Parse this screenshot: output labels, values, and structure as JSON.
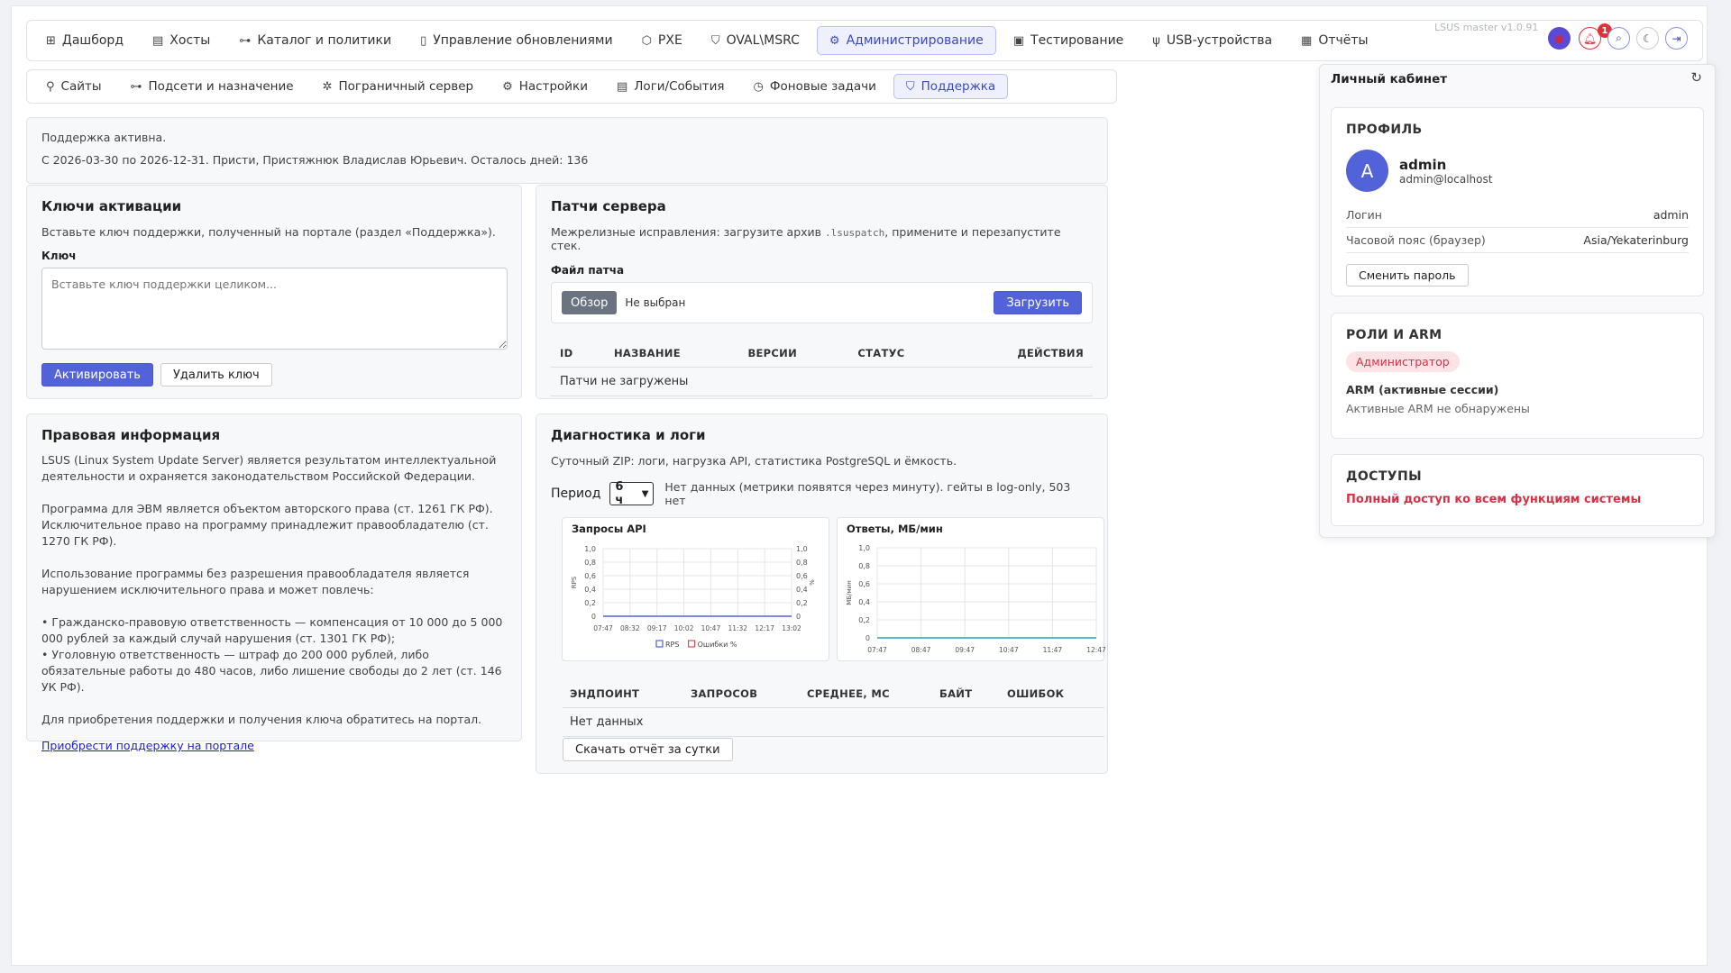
{
  "top_nav": {
    "items": [
      {
        "label": "Дашборд",
        "icon": "dashboard-icon",
        "glyph": "⊞"
      },
      {
        "label": "Хосты",
        "icon": "hosts-icon",
        "glyph": "▤"
      },
      {
        "label": "Каталог и политики",
        "icon": "catalog-icon",
        "glyph": "⊶"
      },
      {
        "label": "Управление обновлениями",
        "icon": "updates-icon",
        "glyph": "▯"
      },
      {
        "label": "PXE",
        "icon": "pxe-icon",
        "glyph": "⬡"
      },
      {
        "label": "OVAL\\MSRC",
        "icon": "shield-check-icon",
        "glyph": "⛉"
      },
      {
        "label": "Администрирование",
        "icon": "admin-icon",
        "glyph": "⚙",
        "active": true
      },
      {
        "label": "Тестирование",
        "icon": "testing-icon",
        "glyph": "▣"
      },
      {
        "label": "USB-устройства",
        "icon": "usb-icon",
        "glyph": "ψ"
      },
      {
        "label": "Отчёты",
        "icon": "reports-icon",
        "glyph": "▦"
      }
    ],
    "version": "LSUS master v1.0.91",
    "notification_count": "1"
  },
  "sub_nav": {
    "items": [
      {
        "label": "Сайты",
        "icon": "sites-icon",
        "glyph": "⚲"
      },
      {
        "label": "Подсети и назначение",
        "icon": "subnets-icon",
        "glyph": "⊶"
      },
      {
        "label": "Пограничный сервер",
        "icon": "edge-server-icon",
        "glyph": "✲"
      },
      {
        "label": "Настройки",
        "icon": "settings-icon",
        "glyph": "⚙"
      },
      {
        "label": "Логи/События",
        "icon": "logs-icon",
        "glyph": "▤"
      },
      {
        "label": "Фоновые задачи",
        "icon": "clock-icon",
        "glyph": "◷"
      },
      {
        "label": "Поддержка",
        "icon": "support-icon",
        "glyph": "⛉",
        "active": true
      }
    ]
  },
  "support_status": {
    "line1": "Поддержка активна.",
    "line2": "С 2026-03-30 по 2026-12-31. Присти, Пристяжнюк Владислав Юрьевич. Осталось дней: 136"
  },
  "activation": {
    "title": "Ключи активации",
    "description": "Вставьте ключ поддержки, полученный на портале (раздел «Поддержка»).",
    "key_label": "Ключ",
    "key_placeholder": "Вставьте ключ поддержки целиком...",
    "activate_button": "Активировать",
    "delete_button": "Удалить ключ"
  },
  "patches": {
    "title": "Патчи сервера",
    "description_before": "Межрелизные исправления: загрузите архив",
    "description_code": ".lsuspatch",
    "description_after": ", примените и перезапустите стек.",
    "file_label": "Файл патча",
    "browse_button": "Обзор",
    "no_file": "Не выбран",
    "upload_button": "Загрузить",
    "columns": [
      "ID",
      "НАЗВАНИЕ",
      "ВЕРСИИ",
      "СТАТУС",
      "ДЕЙСТВИЯ"
    ],
    "empty": "Патчи не загружены"
  },
  "legal": {
    "title": "Правовая информация",
    "p1": "LSUS (Linux System Update Server) является результатом интеллектуальной деятельности и охраняется законодательством Российской Федерации.",
    "p2a": "Программа для ЭВМ является объектом авторского права (ст. 1261 ГК РФ).",
    "p2b": "Исключительное право на программу принадлежит правообладателю (ст. 1270 ГК РФ).",
    "p3": "Использование программы без разрешения правообладателя является нарушением исключительного права и может повлечь:",
    "b1": "• Гражданско-правовую ответственность — компенсация от 10 000 до 5 000 000 рублей за каждый случай нарушения (ст. 1301 ГК РФ);",
    "b2": "• Уголовную ответственность — штраф до 200 000 рублей, либо обязательные работы до 480 часов, либо лишение свободы до 2 лет (ст. 146 УК РФ).",
    "p4": "Для приобретения поддержки и получения ключа обратитесь на портал.",
    "link": "Приобрести поддержку на портале"
  },
  "diagnostics": {
    "title": "Диагностика и логи",
    "description": "Суточный ZIP: логи, нагрузка API, статистика PostgreSQL и ёмкость.",
    "period_label": "Период",
    "period_value": "6 ч",
    "status": "Нет данных (метрики появятся через минуту). гейты в log-only, 503 нет",
    "columns": [
      "ЭНДПОИНТ",
      "ЗАПРОСОВ",
      "СРЕДНЕЕ, МС",
      "БАЙТ",
      "ОШИБОК"
    ],
    "empty": "Нет данных",
    "download_button": "Скачать отчёт за сутки"
  },
  "chart_data": [
    {
      "type": "line",
      "title": "Запросы API",
      "x": [
        "07:47",
        "08:32",
        "09:17",
        "10:02",
        "10:47",
        "11:32",
        "12:17",
        "13:02"
      ],
      "ylabel": "RPS",
      "y2label": "%",
      "ylim": [
        0,
        1.0
      ],
      "y2lim": [
        0,
        1.0
      ],
      "yticks": [
        "1,0",
        "0,8",
        "0,6",
        "0,4",
        "0,2",
        "0"
      ],
      "series": [
        {
          "name": "RPS",
          "values": [
            0,
            0,
            0,
            0,
            0,
            0,
            0,
            0
          ],
          "color": "#5262d9"
        },
        {
          "name": "Ошибки %",
          "values": [],
          "color": "#d9505a"
        }
      ],
      "legend": "bottom",
      "grid": true
    },
    {
      "type": "line",
      "title": "Ответы, МБ/мин",
      "x": [
        "07:47",
        "08:47",
        "09:47",
        "10:47",
        "11:47",
        "12:47"
      ],
      "ylabel": "МБ/мин",
      "ylim": [
        0,
        1.0
      ],
      "yticks": [
        "1,0",
        "0,8",
        "0,6",
        "0,4",
        "0,2",
        "0"
      ],
      "series": [
        {
          "values": [
            0,
            0,
            0,
            0,
            0,
            0
          ],
          "color": "#1aa8b5"
        }
      ],
      "grid": true
    }
  ],
  "profile": {
    "title": "Личный кабинет",
    "profile_header": "ПРОФИЛЬ",
    "avatar_letter": "A",
    "username": "admin",
    "email": "admin@localhost",
    "login_label": "Логин",
    "login_value": "admin",
    "tz_label": "Часовой пояс (браузер)",
    "tz_value": "Asia/Yekaterinburg",
    "change_password": "Сменить пароль",
    "roles_header": "РОЛИ И ARM",
    "role": "Администратор",
    "arm_label": "ARM (активные сессии)",
    "arm_empty": "Активные ARM не обнаружены",
    "access_header": "ДОСТУПЫ",
    "access_value": "Полный доступ ко всем функциям системы"
  },
  "colors": {
    "accent": "#5262d9",
    "danger": "#d93045",
    "role_badge_bg": "#fde3e6"
  }
}
